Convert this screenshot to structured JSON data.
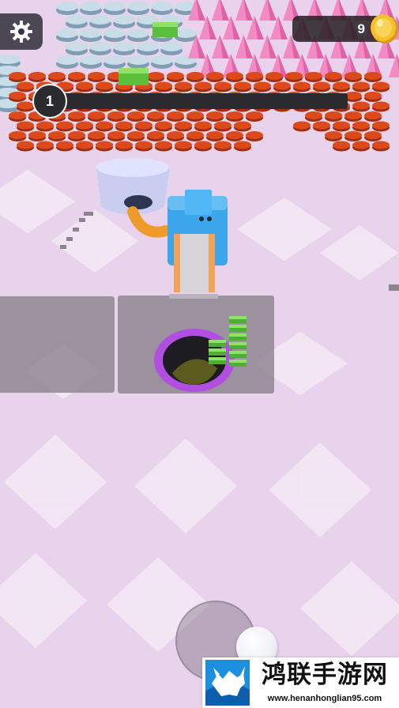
{
  "hud": {
    "settings": {
      "icon": "gear-icon"
    },
    "coins": {
      "value": "9",
      "icon": "gold-coin-icon"
    },
    "level": {
      "number": "1",
      "progress": 0.0
    },
    "joystick": {
      "icon": "virtual-joystick"
    }
  },
  "watermark": {
    "logo_icon": "bull-logo-icon",
    "title": "鸿联手游网",
    "url": "www.henanhonglian95.com"
  },
  "colors": {
    "floor": "#e9d3ec",
    "floor_tile": "#f4e9f5",
    "disc_orange": "#dc4a1c",
    "disc_blue": "#a9c6d8",
    "crystal_pink": "#f28ac4",
    "machine_blue": "#3da6ea",
    "hole_ring": "#b04fe0",
    "cash_green": "#6cd14a",
    "coin_gold": "#f5c02b"
  }
}
